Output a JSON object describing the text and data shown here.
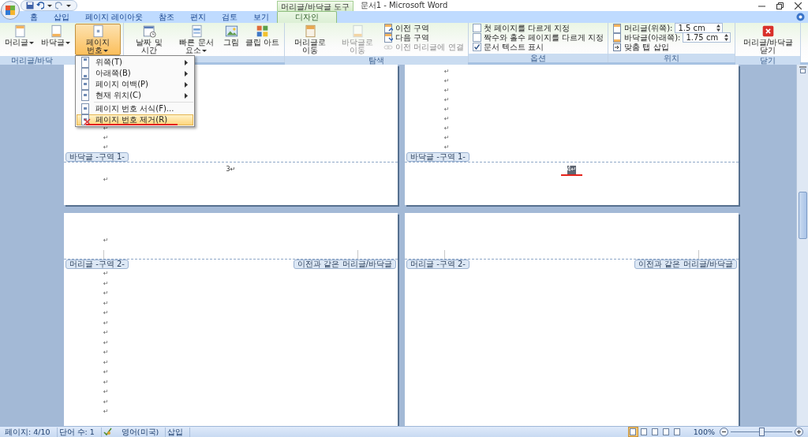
{
  "window": {
    "title": "문서1 - Microsoft Word"
  },
  "tabs": [
    {
      "label": "홈",
      "selected": false
    },
    {
      "label": "삽입",
      "selected": false
    },
    {
      "label": "페이지 레이아웃",
      "selected": false
    },
    {
      "label": "참조",
      "selected": false
    },
    {
      "label": "편지",
      "selected": false
    },
    {
      "label": "검토",
      "selected": false
    },
    {
      "label": "보기",
      "selected": false
    },
    {
      "label": "디자인",
      "selected": true,
      "context": "머리글/바닥글 도구"
    }
  ],
  "ribbon_groups": [
    {
      "label": "머리글/바닥",
      "buttons": [
        {
          "kind": "large",
          "label": "머리글",
          "dropdown": true,
          "selected": false
        },
        {
          "kind": "large",
          "label": "바닥글",
          "dropdown": true,
          "selected": false
        },
        {
          "kind": "large",
          "label": "페이지 번호",
          "dropdown": true,
          "selected": true,
          "menu": {
            "items": [
              {
                "label": "위쪽(T)",
                "submenu": true,
                "selected": false,
                "marked": false
              },
              {
                "label": "아래쪽(B)",
                "submenu": true,
                "selected": false,
                "marked": false
              },
              {
                "label": "페이지 여백(P)",
                "submenu": true,
                "selected": false,
                "marked": false
              },
              {
                "label": "현재 위치(C)",
                "submenu": true,
                "selected": false,
                "marked": false
              },
              {
                "label": "페이지 번호 서식(F)...",
                "submenu": false,
                "selected": false,
                "marked": false
              },
              {
                "label": "페이지 번호 제거(R)",
                "submenu": false,
                "selected": true,
                "marked": true
              }
            ]
          }
        }
      ]
    },
    {
      "buttons": [
        {
          "kind": "large",
          "label": "날짜 및 시간",
          "dropdown": false
        },
        {
          "kind": "large",
          "label": "빠른 문서 요소",
          "dropdown": true
        },
        {
          "kind": "large",
          "label": "그림",
          "dropdown": false
        },
        {
          "kind": "large",
          "label": "클립 아트",
          "dropdown": false
        }
      ]
    },
    {
      "label": "탐색",
      "buttons": [
        {
          "kind": "large",
          "label": "머리글로 이동",
          "disabled": false
        },
        {
          "kind": "large",
          "label": "바닥글로 이동",
          "disabled": true
        },
        {
          "kind": "small",
          "label": "이전 구역",
          "disabled": false
        },
        {
          "kind": "small",
          "label": "다음 구역",
          "disabled": false
        },
        {
          "kind": "small",
          "label": "이전 머리글에 연결",
          "disabled": true
        }
      ]
    },
    {
      "label": "옵션",
      "buttons": [
        {
          "kind": "checkbox",
          "label": "첫 페이지를 다르게 지정",
          "checked": false
        },
        {
          "kind": "checkbox",
          "label": "짝수와 홀수 페이지를 다르게 지정",
          "checked": false
        },
        {
          "kind": "checkbox",
          "label": "문서 텍스트 표시",
          "checked": true
        }
      ]
    },
    {
      "label": "위치",
      "buttons": [
        {
          "kind": "spinner",
          "label": "머리글(위쪽):",
          "value": "1.5 cm"
        },
        {
          "kind": "spinner",
          "label": "바닥글(아래쪽):",
          "value": "1.75 cm"
        },
        {
          "kind": "small",
          "label": "맞춤 탭 삽입",
          "disabled": false
        }
      ]
    },
    {
      "label": "닫기",
      "buttons": [
        {
          "kind": "large",
          "label": "머리글/바닥글 닫기"
        }
      ]
    }
  ],
  "pages": [
    {
      "marks_above": [
        "↵",
        "↵",
        "↵"
      ],
      "divider": {
        "kind": "footer",
        "label": "바닥글 -구역 1-"
      },
      "number": {
        "text": "3↵",
        "highlighted": false,
        "marked": false
      },
      "marks_below": [
        "↵"
      ]
    },
    {
      "marks_above": [
        "↵",
        "↵",
        "↵",
        "↵",
        "↵",
        "↵",
        "↵",
        "↵",
        "↵"
      ],
      "divider": {
        "kind": "footer",
        "label": "바닥글 -구역 1-"
      },
      "number": {
        "text": "4↵",
        "highlighted": true,
        "marked": true
      }
    },
    {
      "marks_above": [
        "↵"
      ],
      "divider": {
        "kind": "header",
        "label": "머리글 -구역 2-",
        "note": "이전과 같은 머리글/바닥글"
      },
      "marks_below": [
        "↵",
        "↵",
        "↵",
        "↵",
        "↵",
        "↵",
        "↵",
        "↵",
        "↵",
        "↵",
        "↵",
        "↵",
        "↵",
        "↵",
        "↵"
      ]
    },
    {
      "divider": {
        "kind": "header",
        "label": "머리글 -구역 2-",
        "note": "이전과 같은 머리글/바닥글"
      }
    }
  ],
  "status_bar": {
    "page": "페이지: 4/10",
    "words": "단어 수: 1",
    "language": "영어(미국)",
    "mode": "삽입",
    "views": [
      {
        "selected": true
      },
      {
        "selected": false
      },
      {
        "selected": false
      },
      {
        "selected": false
      },
      {
        "selected": false
      }
    ],
    "zoom": {
      "reading": "100%",
      "level": 0.5
    }
  }
}
